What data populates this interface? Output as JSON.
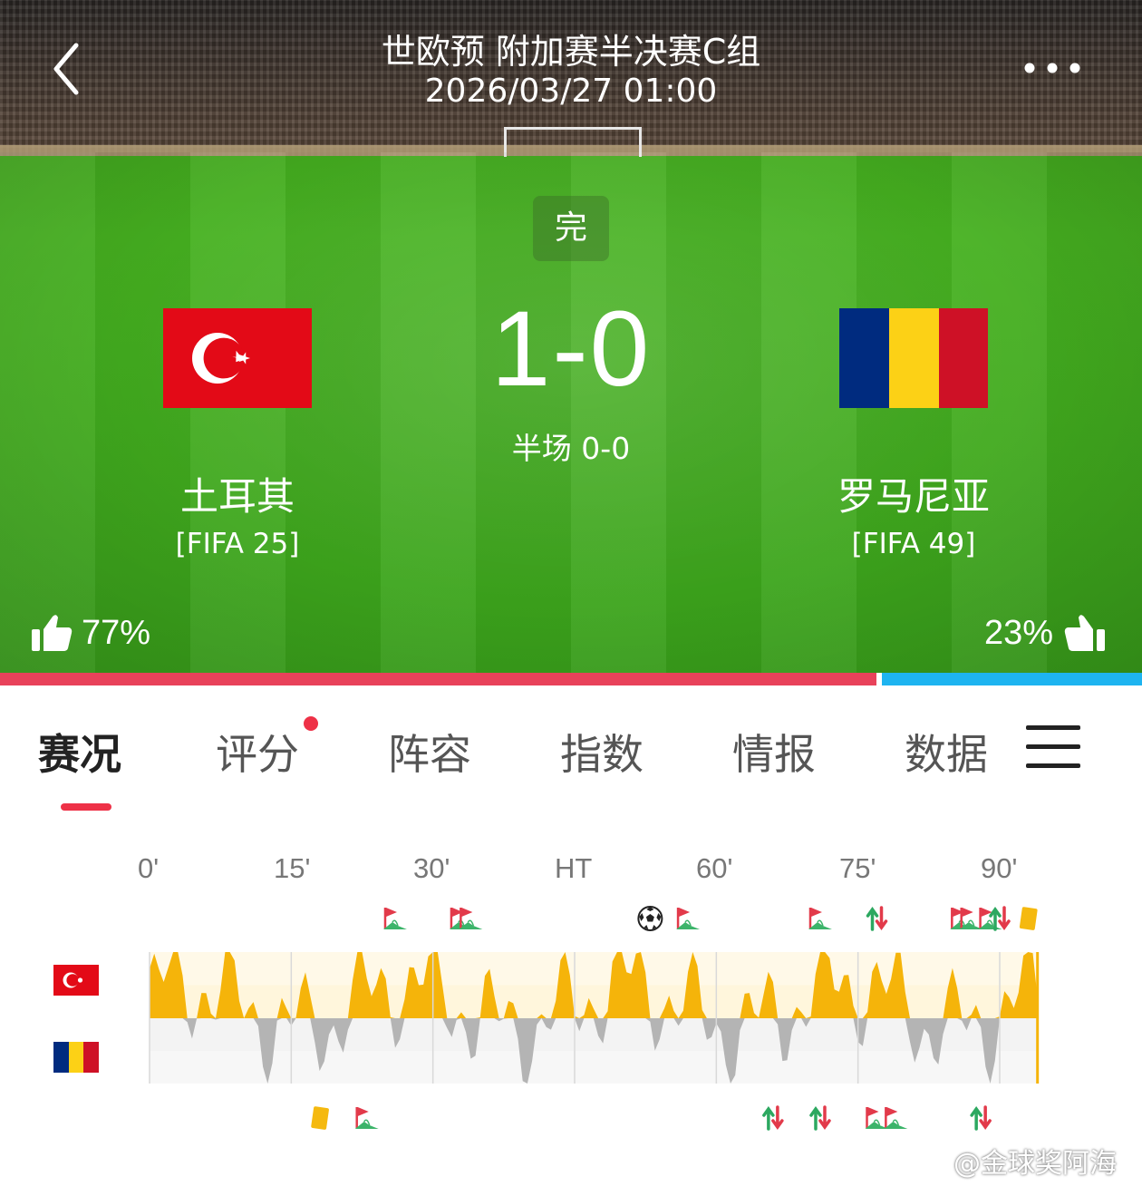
{
  "header": {
    "title": "世欧预 附加赛半决赛C组",
    "datetime": "2026/03/27 01:00"
  },
  "match": {
    "status": "完",
    "score": "1-0",
    "halftime": "半场 0-0"
  },
  "home": {
    "name": "土耳其",
    "rank": "[FIFA 25]",
    "vote": "77%",
    "flag": "turkey"
  },
  "away": {
    "name": "罗马尼亚",
    "rank": "[FIFA 49]",
    "vote": "23%",
    "flag": "romania"
  },
  "vote_ratio": {
    "home": 0.77,
    "away": 0.23
  },
  "colors": {
    "accent": "#ee3147",
    "home_bar": "#e8425a",
    "away_bar": "#1eb4f0",
    "momentum_home": "#f5b40a",
    "momentum_away": "#b4b4b4"
  },
  "tabs": [
    {
      "label": "赛况",
      "active": true
    },
    {
      "label": "评分",
      "active": false,
      "badge": true
    },
    {
      "label": "阵容",
      "active": false
    },
    {
      "label": "指数",
      "active": false
    },
    {
      "label": "情报",
      "active": false
    },
    {
      "label": "数据",
      "active": false
    }
  ],
  "timeline": {
    "ticks": [
      "0'",
      "15'",
      "30'",
      "HT",
      "60'",
      "75'",
      "90'"
    ],
    "home_events": [
      {
        "type": "corner-icon",
        "minute": 26
      },
      {
        "type": "corner-icon",
        "minute": 33
      },
      {
        "type": "corner-icon",
        "minute": 34
      },
      {
        "type": "goal-icon",
        "minute": 53
      },
      {
        "type": "corner-icon",
        "minute": 57
      },
      {
        "type": "corner-icon",
        "minute": 71
      },
      {
        "type": "substitution-icon",
        "minute": 77
      },
      {
        "type": "corner-icon",
        "minute": 86
      },
      {
        "type": "corner-icon",
        "minute": 87
      },
      {
        "type": "corner-icon",
        "minute": 89
      },
      {
        "type": "substitution-icon",
        "minute": 90
      },
      {
        "type": "yellow-card-icon",
        "minute": 93
      }
    ],
    "away_events": [
      {
        "type": "yellow-card-icon",
        "minute": 18
      },
      {
        "type": "corner-icon",
        "minute": 23
      },
      {
        "type": "substitution-icon",
        "minute": 66
      },
      {
        "type": "substitution-icon",
        "minute": 71
      },
      {
        "type": "corner-icon",
        "minute": 77
      },
      {
        "type": "corner-icon",
        "minute": 79
      },
      {
        "type": "substitution-icon",
        "minute": 88
      }
    ]
  },
  "watermark": "@金球奖阿海"
}
